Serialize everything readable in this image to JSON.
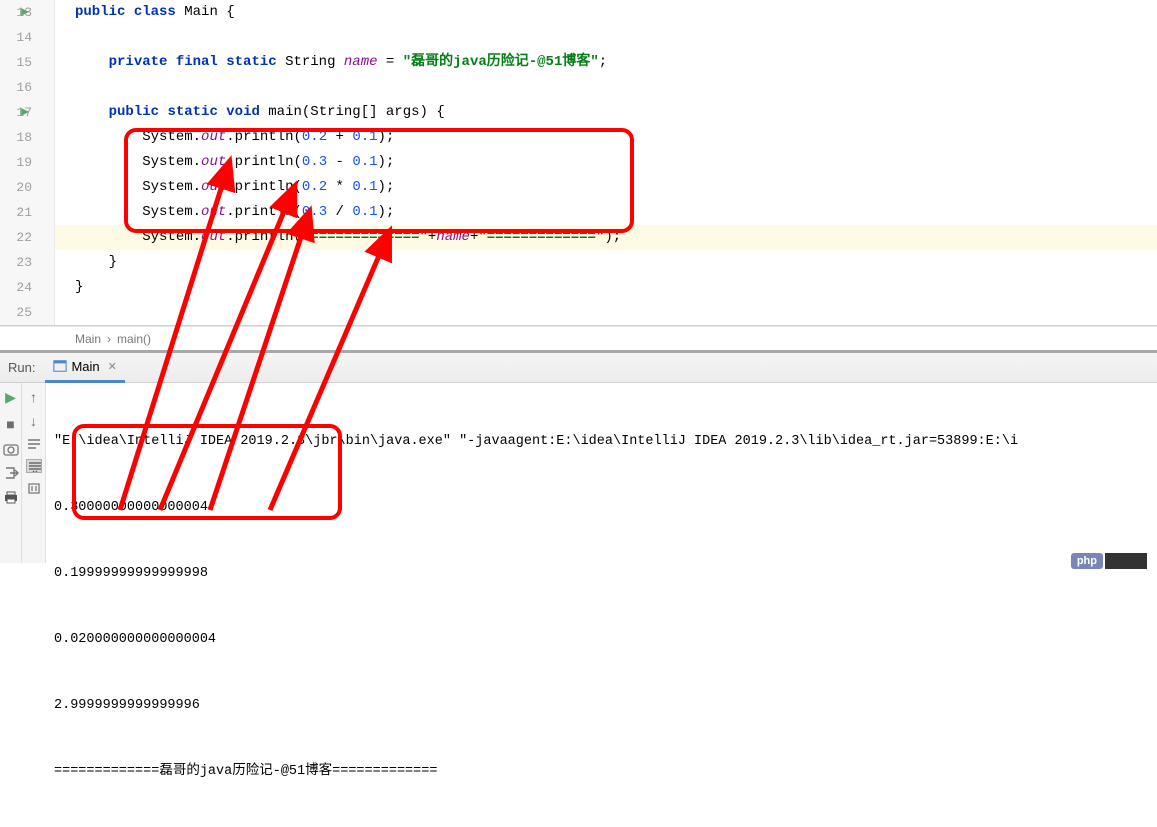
{
  "editor": {
    "lines": {
      "13": {
        "num": "13",
        "run": true
      },
      "14": {
        "num": "14"
      },
      "15": {
        "num": "15"
      },
      "16": {
        "num": "16"
      },
      "17": {
        "num": "17",
        "run": true
      },
      "18": {
        "num": "18"
      },
      "19": {
        "num": "19"
      },
      "20": {
        "num": "20"
      },
      "21": {
        "num": "21"
      },
      "22": {
        "num": "22"
      },
      "23": {
        "num": "23"
      },
      "24": {
        "num": "24"
      },
      "25": {
        "num": "25"
      }
    },
    "tokens": {
      "public": "public",
      "class": "class",
      "Main": "Main",
      "private": "private",
      "final": "final",
      "static": "static",
      "String": "String",
      "name": "name",
      "eq": " = ",
      "nameVal": "\"磊哥的java历险记-@51博客\"",
      "void": "void",
      "main": "main",
      "args": "(String[] args) {",
      "System": "System",
      "dot": ".",
      "out": "out",
      "println": ".println(",
      "n02": "0.2",
      "n01": "0.1",
      "n03": "0.3",
      "plus": " + ",
      "minus": " - ",
      "times": " * ",
      "div": " / ",
      "close": ");",
      "sep1": "\"=============\"",
      "sep2": "\"=============\"",
      "plusName": "+",
      "nameRef": "name",
      "brace": "{",
      "cbrace": "}",
      "semi": ";"
    }
  },
  "breadcrumbs": {
    "cls": "Main",
    "method": "main()",
    "sep": "›"
  },
  "run": {
    "label": "Run:",
    "tabName": "Main"
  },
  "console": {
    "line0": "\"E:\\idea\\IntelliJ IDEA 2019.2.3\\jbr\\bin\\java.exe\" \"-javaagent:E:\\idea\\IntelliJ IDEA 2019.2.3\\lib\\idea_rt.jar=53899:E:\\i",
    "line1": "0.30000000000000004",
    "line2": "0.19999999999999998",
    "line3": "0.020000000000000004",
    "line4": "2.9999999999999996",
    "line5": "=============磊哥的java历险记-@51博客============="
  },
  "watermark": {
    "text": "php"
  }
}
